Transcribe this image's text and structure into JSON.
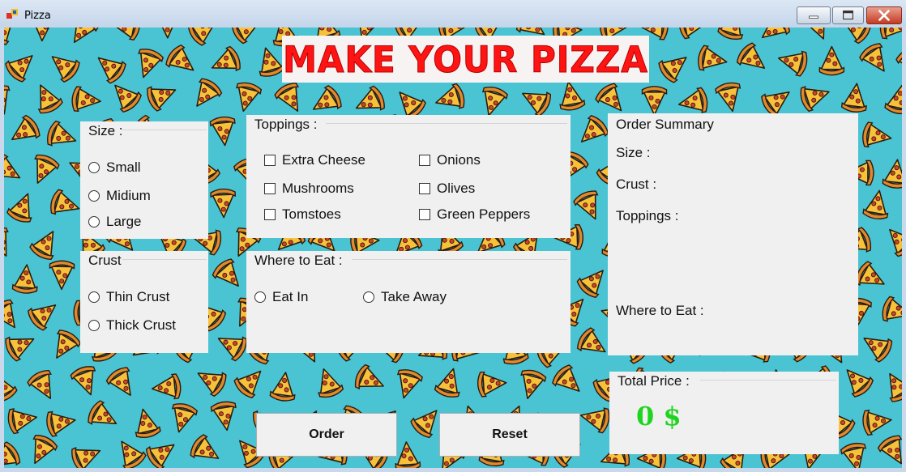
{
  "window": {
    "title": "Pizza",
    "controls": {
      "minimize": "minimize",
      "maximize": "maximize",
      "close": "close"
    }
  },
  "banner": {
    "text": "MAKE YOUR PIZZA"
  },
  "size_group": {
    "title": "Size :",
    "options": [
      {
        "label": "Small",
        "selected": false
      },
      {
        "label": "Midium",
        "selected": false
      },
      {
        "label": "Large",
        "selected": false
      }
    ]
  },
  "toppings_group": {
    "title": "Toppings :",
    "options": [
      {
        "label": "Extra Cheese",
        "checked": false
      },
      {
        "label": "Mushrooms",
        "checked": false
      },
      {
        "label": "Tomstoes",
        "checked": false
      },
      {
        "label": "Onions",
        "checked": false
      },
      {
        "label": "Olives",
        "checked": false
      },
      {
        "label": "Green Peppers",
        "checked": false
      }
    ]
  },
  "crust_group": {
    "title": "Crust",
    "options": [
      {
        "label": "Thin Crust",
        "selected": false
      },
      {
        "label": "Thick Crust",
        "selected": false
      }
    ]
  },
  "where_group": {
    "title": "Where to Eat :",
    "options": [
      {
        "label": "Eat In",
        "selected": false
      },
      {
        "label": "Take Away",
        "selected": false
      }
    ]
  },
  "order_summary": {
    "title": "Order Summary",
    "size_label": "Size :",
    "crust_label": "Crust :",
    "toppings_label": "Toppings :",
    "where_label": "Where to Eat :"
  },
  "total_price": {
    "title": "Total Price :",
    "value": "0 $"
  },
  "buttons": {
    "order": "Order",
    "reset": "Reset"
  },
  "colors": {
    "background": "#4ac3d3",
    "banner_text": "#ff1414",
    "price_text": "#1fd41f",
    "panel": "#f0f0f0"
  },
  "icons": {
    "app": "pizza-app-icon",
    "background_motif": "pizza-slice-icon"
  }
}
